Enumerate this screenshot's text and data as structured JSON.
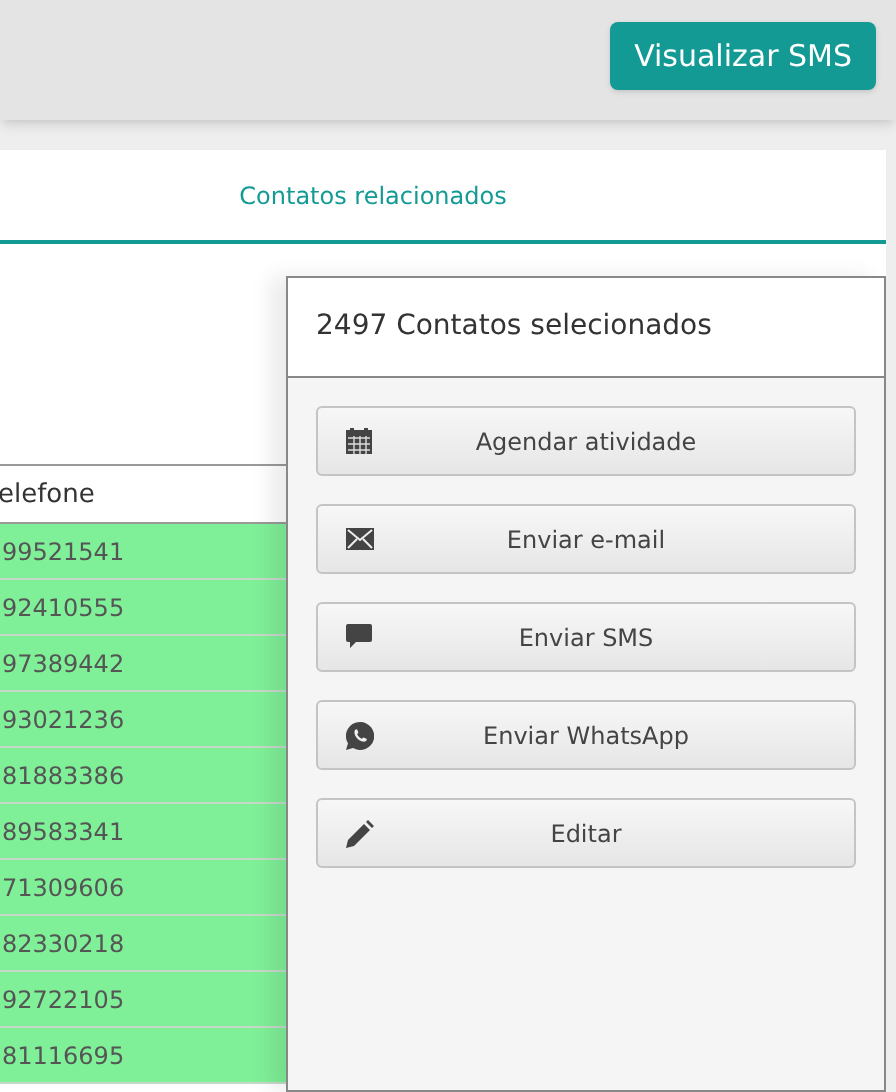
{
  "header": {
    "button": "Visualizar SMS"
  },
  "tabs": [
    {
      "label": "Contatos relacionados",
      "selected": true
    }
  ],
  "table": {
    "column": "elefone",
    "rows": [
      {
        "value": "99521541",
        "selected": true
      },
      {
        "value": "92410555",
        "selected": true
      },
      {
        "value": "97389442",
        "selected": true
      },
      {
        "value": "93021236",
        "selected": true
      },
      {
        "value": "81883386",
        "selected": true
      },
      {
        "value": "89583341",
        "selected": true
      },
      {
        "value": "71309606",
        "selected": true
      },
      {
        "value": "82330218",
        "selected": true
      },
      {
        "value": "92722105",
        "selected": true
      },
      {
        "value": "81116695",
        "selected": true
      }
    ]
  },
  "panel": {
    "title": "2497 Contatos selecionados",
    "actions": [
      {
        "kind": "calendar",
        "label": "Agendar atividade"
      },
      {
        "kind": "email",
        "label": "Enviar e-mail"
      },
      {
        "kind": "sms",
        "label": "Enviar SMS"
      },
      {
        "kind": "whatsapp",
        "label": "Enviar WhatsApp"
      },
      {
        "kind": "edit",
        "label": "Editar"
      }
    ]
  }
}
